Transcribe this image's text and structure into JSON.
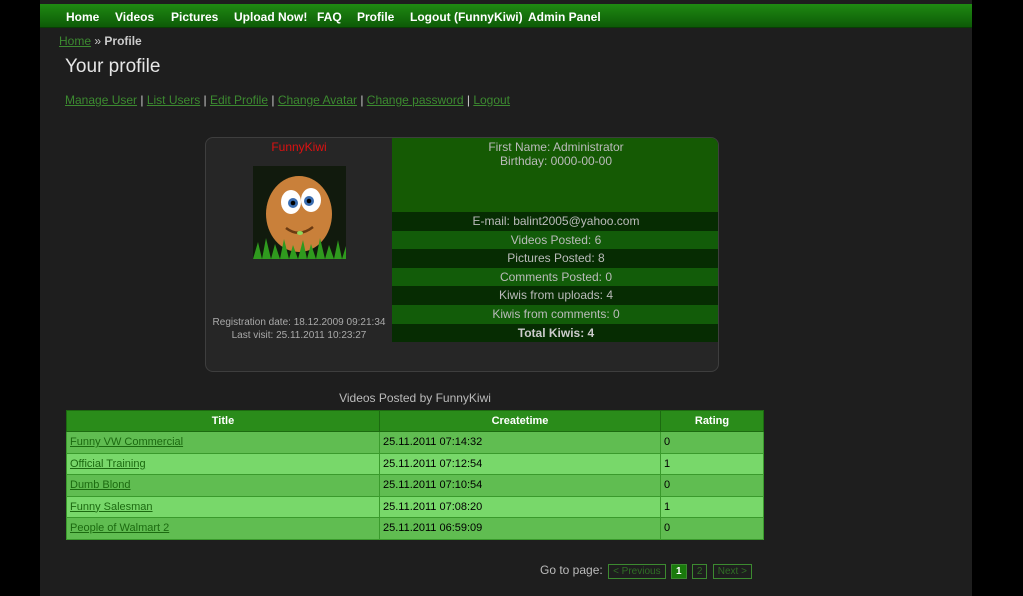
{
  "nav": [
    "Home",
    "Videos",
    "Pictures",
    "Upload Now!",
    "FAQ",
    "Profile",
    "Logout (FunnyKiwi)",
    "Admin Panel"
  ],
  "breadcrumb": {
    "home": "Home",
    "sep": "»",
    "current": "Profile"
  },
  "page_title": "Your profile",
  "actions": [
    "Manage User",
    "List Users",
    "Edit Profile",
    "Change Avatar",
    "Change password",
    "Logout"
  ],
  "profile": {
    "username": "FunnyKiwi",
    "registration": "Registration date: 18.12.2009 09:21:34",
    "last_visit": "Last visit: 25.11.2011 10:23:27",
    "first_name": "First Name: Administrator",
    "birthday": "Birthday: 0000-00-00",
    "email": "E-mail: balint2005@yahoo.com",
    "videos": "Videos Posted: 6",
    "pictures": "Pictures Posted: 8",
    "comments": "Comments Posted: 0",
    "kiwis_uploads": "Kiwis from uploads: 4",
    "kiwis_comments": "Kiwis from comments: 0",
    "total": "Total Kiwis: 4"
  },
  "videos_caption": "Videos Posted by FunnyKiwi",
  "table": {
    "headers": [
      "Title",
      "Createtime",
      "Rating"
    ],
    "rows": [
      [
        "Funny VW Commercial",
        "25.11.2011 07:14:32",
        "0"
      ],
      [
        "Official Training",
        "25.11.2011 07:12:54",
        "1"
      ],
      [
        "Dumb Blond",
        "25.11.2011 07:10:54",
        "0"
      ],
      [
        "Funny Salesman",
        "25.11.2011 07:08:20",
        "1"
      ],
      [
        "People of Walmart 2",
        "25.11.2011 06:59:09",
        "0"
      ]
    ]
  },
  "pager": {
    "label": "Go to page:",
    "prev": "< Previous",
    "p1": "1",
    "p2": "2",
    "next": "Next >"
  },
  "colors": {
    "nav_bg": "#1f8a12",
    "link": "#3c8a30",
    "username": "#d11111"
  }
}
